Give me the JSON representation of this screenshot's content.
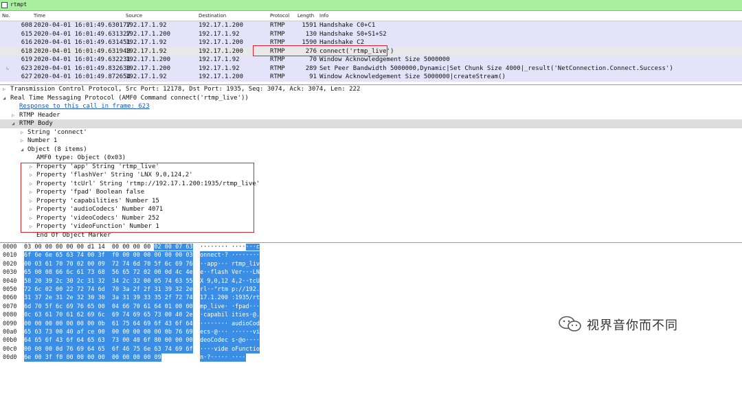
{
  "filter": {
    "text": "rtmpt"
  },
  "packet_list": {
    "columns": [
      "No.",
      "Time",
      "Source",
      "Destination",
      "Protocol",
      "Length",
      "Info"
    ],
    "rows": [
      {
        "no": "608",
        "time": "2020-04-01 16:01:49.630177",
        "src": "192.17.1.92",
        "dst": "192.17.1.200",
        "proto": "RTMP",
        "len": "1591",
        "info": "Handshake C0+C1"
      },
      {
        "no": "615",
        "time": "2020-04-01 16:01:49.631327",
        "src": "192.17.1.200",
        "dst": "192.17.1.92",
        "proto": "RTMP",
        "len": "130",
        "info": "Handshake S0+S1+S2"
      },
      {
        "no": "616",
        "time": "2020-04-01 16:01:49.631451",
        "src": "192.17.1.92",
        "dst": "192.17.1.200",
        "proto": "RTMP",
        "len": "1590",
        "info": "Handshake C2"
      },
      {
        "no": "618",
        "time": "2020-04-01 16:01:49.631948",
        "src": "192.17.1.92",
        "dst": "192.17.1.200",
        "proto": "RTMP",
        "len": "276",
        "info": "connect('rtmp_live')"
      },
      {
        "no": "619",
        "time": "2020-04-01 16:01:49.632231",
        "src": "192.17.1.200",
        "dst": "192.17.1.92",
        "proto": "RTMP",
        "len": "70",
        "info": "Window Acknowledgement Size 5000000"
      },
      {
        "no": "623",
        "time": "2020-04-01 16:01:49.832630",
        "src": "192.17.1.200",
        "dst": "192.17.1.92",
        "proto": "RTMP",
        "len": "289",
        "info": "Set Peer Bandwidth 5000000,Dynamic|Set Chunk Size 4000|_result('NetConnection.Connect.Success')"
      },
      {
        "no": "627",
        "time": "2020-04-01 16:01:49.872654",
        "src": "192.17.1.92",
        "dst": "192.17.1.200",
        "proto": "RTMP",
        "len": "91",
        "info": "Window Acknowledgement Size 5000000|createStream()"
      }
    ]
  },
  "details": {
    "tcp": "Transmission Control Protocol, Src Port: 12178, Dst Port: 1935, Seq: 3074, Ack: 3074, Len: 222",
    "rtmp": "Real Time Messaging Protocol (AMF0 Command connect('rtmp_live'))",
    "response_link": "Response to this call in frame: 623",
    "rtmp_header": "RTMP Header",
    "rtmp_body": "RTMP Body",
    "string": "String 'connect'",
    "number": "Number 1",
    "object": "Object (8 items)",
    "amf0_type": "AMF0 type: Object (0x03)",
    "properties": [
      "Property 'app' String 'rtmp_live'",
      "Property 'flashVer' String 'LNX 9,0,124,2'",
      "Property 'tcUrl' String 'rtmp://192.17.1.200:1935/rtmp_live'",
      "Property 'fpad' Boolean false",
      "Property 'capabilities' Number 15",
      "Property 'audioCodecs' Number 4071",
      "Property 'videoCodecs' Number 252",
      "Property 'videoFunction' Number 1"
    ],
    "end_marker": "End Of Object Marker"
  },
  "bytes": {
    "rows": [
      {
        "off": "0000",
        "hex_plain": "03 00 00 00 00 00 d1 14  00 00 00 00 ",
        "hex_sel": "02 00 07 63",
        "asc_plain": "········ ····",
        "asc_sel": "···c"
      },
      {
        "off": "0010",
        "hex_plain": "",
        "hex_sel": "6f 6e 6e 65 63 74 00 3f  f0 00 00 00 00 00 00 03",
        "asc_plain": "",
        "asc_sel": "onnect·? ········"
      },
      {
        "off": "0020",
        "hex_plain": "",
        "hex_sel": "00 03 61 70 70 02 00 09  72 74 6d 70 5f 6c 69 76",
        "asc_plain": "",
        "asc_sel": "··app··· rtmp_liv"
      },
      {
        "off": "0030",
        "hex_plain": "",
        "hex_sel": "65 00 08 66 6c 61 73 68  56 65 72 02 00 0d 4c 4e",
        "asc_plain": "",
        "asc_sel": "e··flash Ver···LN"
      },
      {
        "off": "0040",
        "hex_plain": "",
        "hex_sel": "58 20 39 2c 30 2c 31 32  34 2c 32 00 05 74 63 55",
        "asc_plain": "",
        "asc_sel": "X 9,0,12 4,2··tcU"
      },
      {
        "off": "0050",
        "hex_plain": "",
        "hex_sel": "72 6c 02 00 22 72 74 6d  70 3a 2f 2f 31 39 32 2e",
        "asc_plain": "",
        "asc_sel": "rl··\"rtm p://192."
      },
      {
        "off": "0060",
        "hex_plain": "",
        "hex_sel": "31 37 2e 31 2e 32 30 30  3a 31 39 33 35 2f 72 74",
        "asc_plain": "",
        "asc_sel": "17.1.200 :1935/rt"
      },
      {
        "off": "0070",
        "hex_plain": "",
        "hex_sel": "6d 70 5f 6c 69 76 65 00  04 66 70 61 64 01 00 00",
        "asc_plain": "",
        "asc_sel": "mp_live· ·fpad···"
      },
      {
        "off": "0080",
        "hex_plain": "",
        "hex_sel": "0c 63 61 70 61 62 69 6c  69 74 69 65 73 00 40 2e",
        "asc_plain": "",
        "asc_sel": "·capabil ities·@."
      },
      {
        "off": "0090",
        "hex_plain": "",
        "hex_sel": "00 00 00 00 00 00 00 0b  61 75 64 69 6f 43 6f 64",
        "asc_plain": "",
        "asc_sel": "········ audioCod"
      },
      {
        "off": "00a0",
        "hex_plain": "",
        "hex_sel": "65 63 73 00 40 af ce 00  00 00 00 00 00 0b 76 69",
        "asc_plain": "",
        "asc_sel": "ecs·@··· ······vi"
      },
      {
        "off": "00b0",
        "hex_plain": "",
        "hex_sel": "64 65 6f 43 6f 64 65 63  73 00 40 6f 80 00 00 00",
        "asc_plain": "",
        "asc_sel": "deoCodec s·@o····"
      },
      {
        "off": "00c0",
        "hex_plain": "",
        "hex_sel": "00 00 00 0d 76 69 64 65  6f 46 75 6e 63 74 69 6f",
        "asc_plain": "",
        "asc_sel": "····vide oFunctio"
      },
      {
        "off": "00d0",
        "hex_plain": "",
        "hex_sel": "6e 00 3f f0 00 00 00 00  00 00 00 00 09",
        "asc_plain": "",
        "asc_sel": "n·?····· ····"
      }
    ]
  },
  "watermark": {
    "text": "视界音你而不同",
    "icon": "wechat-icon"
  }
}
